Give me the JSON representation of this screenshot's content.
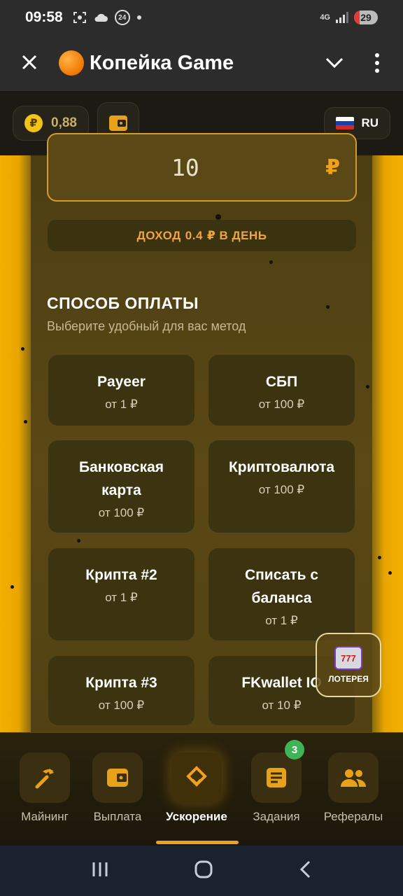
{
  "status_bar": {
    "time": "09:58",
    "network": "4G",
    "battery": "29",
    "notif_badge": "24"
  },
  "app_bar": {
    "title": "Копейка Game"
  },
  "top": {
    "balance": "0,88",
    "coin_symbol": "₽",
    "language": "RU"
  },
  "amount": {
    "value": "10",
    "currency": "₽"
  },
  "income": {
    "prefix": "ДОХОД",
    "value": "0.4",
    "suffix": "₽ В ДЕНЬ"
  },
  "payment": {
    "title": "СПОСОБ ОПЛАТЫ",
    "subtitle": "Выберите удобный для вас метод",
    "methods": [
      {
        "name": "Payeer",
        "min": "от 1 ₽"
      },
      {
        "name": "СБП",
        "min": "от 100 ₽"
      },
      {
        "name": "Банковская карта",
        "min": "от 100 ₽"
      },
      {
        "name": "Криптовалюта",
        "min": "от 100 ₽"
      },
      {
        "name": "Крипта #2",
        "min": "от 1 ₽"
      },
      {
        "name": "Списать с баланса",
        "min": "от 1 ₽"
      },
      {
        "name": "Крипта #3",
        "min": "от 100 ₽"
      },
      {
        "name": "FKwallet IO",
        "min": "от 10 ₽"
      }
    ]
  },
  "lottery": {
    "label": "ЛОТЕРЕЯ",
    "reels": "777"
  },
  "bottom_nav": {
    "items": [
      {
        "label": "Майнинг",
        "icon": "pickaxe-icon"
      },
      {
        "label": "Выплата",
        "icon": "wallet-icon"
      },
      {
        "label": "Ускорение",
        "icon": "boost-icon",
        "active": true
      },
      {
        "label": "Задания",
        "icon": "tasks-icon",
        "badge": "3"
      },
      {
        "label": "Рефералы",
        "icon": "referrals-icon"
      }
    ]
  },
  "colors": {
    "accent": "#f0a020",
    "badge": "#3fb457",
    "card": "#3c3410"
  }
}
